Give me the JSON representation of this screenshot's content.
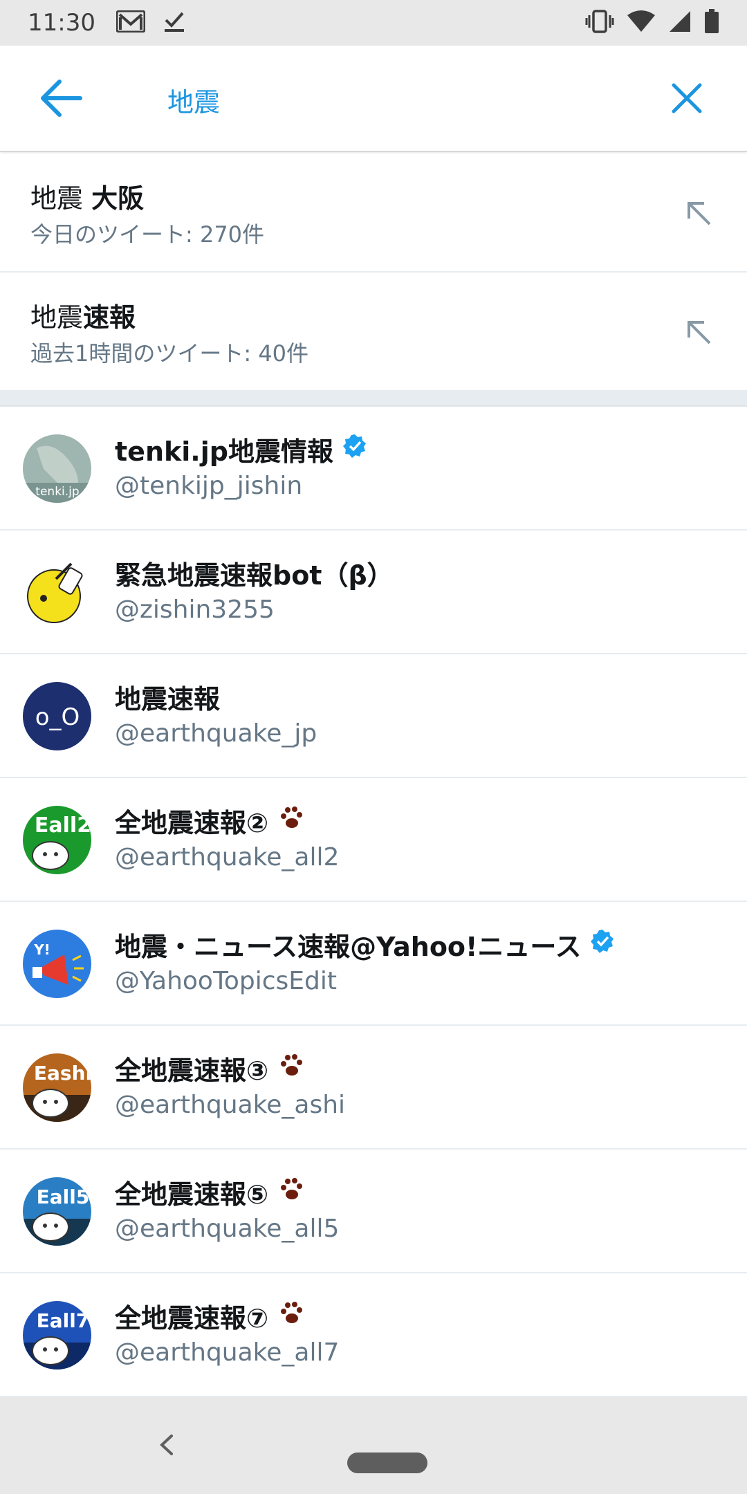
{
  "status_bar": {
    "time": "11:30",
    "icons_left": [
      "gmail-icon",
      "check-icon"
    ],
    "icons_right": [
      "vibrate-icon",
      "wifi-icon",
      "signal-icon",
      "battery-icon"
    ]
  },
  "search": {
    "query": "地震",
    "back_icon": "arrow-left-icon",
    "clear_icon": "close-icon",
    "accent_color": "#1b95e0"
  },
  "suggestions": [
    {
      "query_prefix": "地震 ",
      "query_bold": "大阪",
      "meta": "今日のツイート: 270件"
    },
    {
      "query_prefix": "地震",
      "query_bold": "速報",
      "meta": "過去1時間のツイート: 40件"
    }
  ],
  "users": [
    {
      "name": "tenki.jp地震情報",
      "handle": "@tenkijp_jishin",
      "verified": true,
      "paw": false,
      "avatar_text": "tenki.jp"
    },
    {
      "name": "緊急地震速報bot（β）",
      "handle": "@zishin3255",
      "verified": false,
      "paw": false,
      "avatar_text": ""
    },
    {
      "name": "地震速報",
      "handle": "@earthquake_jp",
      "verified": false,
      "paw": false,
      "avatar_text": "o_O"
    },
    {
      "name": "全地震速報②",
      "handle": "@earthquake_all2",
      "verified": false,
      "paw": true,
      "avatar_text": "Eall2"
    },
    {
      "name": "地震・ニュース速報@Yahoo!ニュース",
      "handle": "@YahooTopicsEdit",
      "verified": true,
      "paw": false,
      "avatar_text": "Y!"
    },
    {
      "name": "全地震速報③",
      "handle": "@earthquake_ashi",
      "verified": false,
      "paw": true,
      "avatar_text": "Eashi"
    },
    {
      "name": "全地震速報⑤",
      "handle": "@earthquake_all5",
      "verified": false,
      "paw": true,
      "avatar_text": "Eall5"
    },
    {
      "name": "全地震速報⑦",
      "handle": "@earthquake_all7",
      "verified": false,
      "paw": true,
      "avatar_text": "Eall7"
    }
  ],
  "nav_bar": {
    "back_icon": "nav-back-icon",
    "home_icon": "home-pill-icon"
  }
}
